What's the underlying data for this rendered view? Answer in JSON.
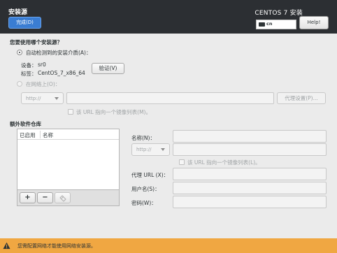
{
  "header": {
    "title": "安装源",
    "done_label": "完成(D)",
    "product": "CENTOS 7 安装",
    "keyboard": "cn",
    "help_label": "Help!"
  },
  "source": {
    "question": "您要使用哪个安装源？",
    "auto_label": "自动检测到的安装介质(A)：",
    "device_label": "设备：",
    "device_value": "sr0",
    "label_label": "标签：",
    "label_value": "CentOS_7_x86_64",
    "verify_label": "验证(V)",
    "network_label": "在网络上(O)：",
    "protocol": "http://",
    "proxy_label": "代理设置(P)...",
    "mirrorlist_label": "该 URL 指向一个镜像列表(M)。"
  },
  "repos": {
    "title": "额外软件仓库",
    "col_enabled": "已启用",
    "col_name": "名称",
    "add_label": "+",
    "remove_label": "−",
    "name_label": "名称(N)：",
    "protocol": "http://",
    "mirrorlist_label": "该 URL 指向一个镜像列表(L)。",
    "proxy_url_label": "代理 URL (X)：",
    "username_label": "用户名(S)：",
    "password_label": "密码(W)："
  },
  "warning": {
    "text": "您需配置网络才能使用网络安装源。",
    "color": "#f0a742"
  },
  "colors": {
    "header_bg": "#2c2f33",
    "accent": "#3a7dd3"
  }
}
